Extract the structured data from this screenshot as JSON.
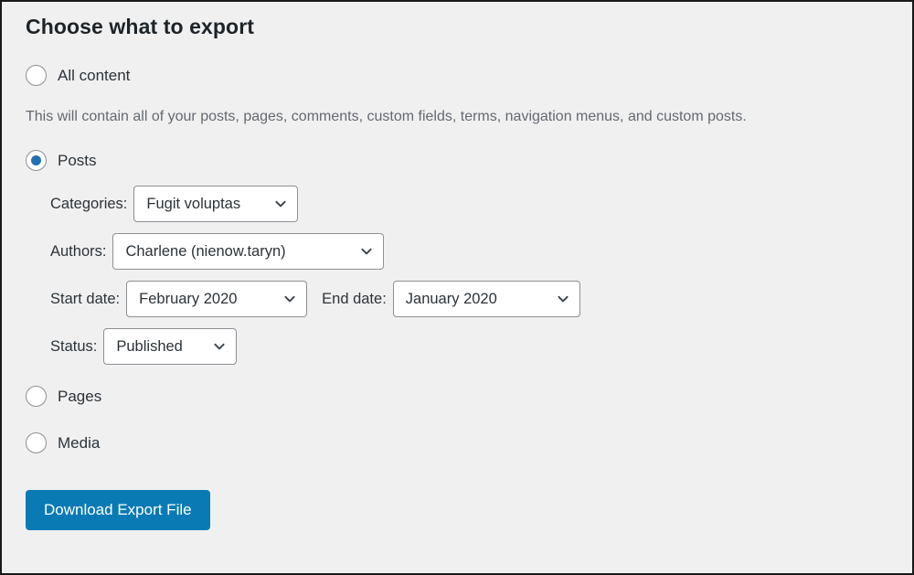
{
  "page": {
    "title": "Choose what to export"
  },
  "options": [
    {
      "id": "all-content",
      "label": "All content",
      "selected": false,
      "description": "This will contain all of your posts, pages, comments, custom fields, terms, navigation menus, and custom posts."
    },
    {
      "id": "posts",
      "label": "Posts",
      "selected": true
    },
    {
      "id": "pages",
      "label": "Pages",
      "selected": false
    },
    {
      "id": "media",
      "label": "Media",
      "selected": false
    }
  ],
  "post_filters": {
    "categories": {
      "label": "Categories:",
      "value": "Fugit voluptas"
    },
    "authors": {
      "label": "Authors:",
      "value": "Charlene (nienow.taryn)"
    },
    "start_date": {
      "label": "Start date:",
      "value": "February 2020"
    },
    "end_date": {
      "label": "End date:",
      "value": "January 2020"
    },
    "status": {
      "label": "Status:",
      "value": "Published"
    }
  },
  "submit": {
    "label": "Download Export File"
  },
  "colors": {
    "accent": "#2271b1",
    "button": "#0a7ab5",
    "background": "#f0f0f1",
    "text": "#2c3338",
    "muted_text": "#646970",
    "heading": "#1d2327",
    "border": "#8c8f94"
  },
  "icons": {
    "chevron": "chevron-down-icon"
  }
}
